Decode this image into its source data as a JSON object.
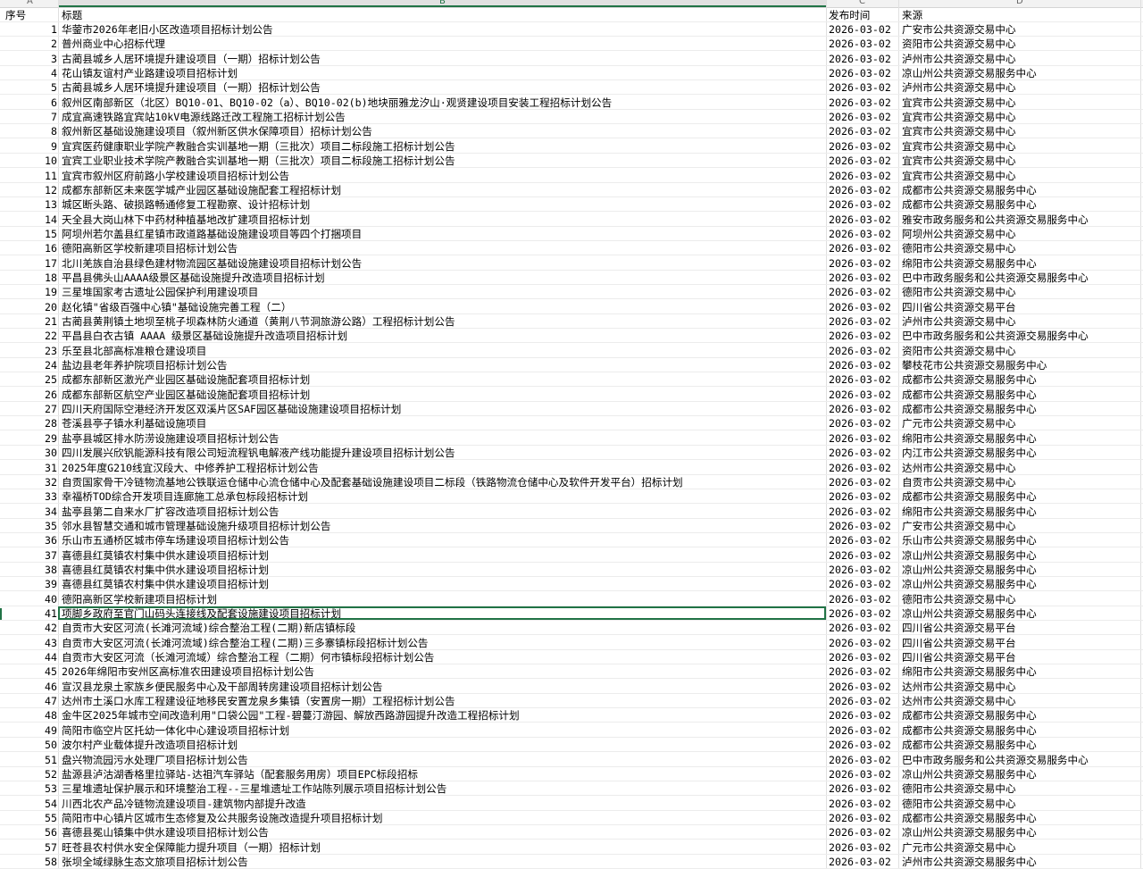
{
  "columns": [
    "A",
    "B",
    "C",
    "D"
  ],
  "header": {
    "a": "序号",
    "b": "标题",
    "c": "发布时间",
    "d": "来源"
  },
  "rows": [
    {
      "no": "1",
      "title": "华蓥市2026年老旧小区改造项目招标计划公告",
      "date": "2026-03-02",
      "source": "广安市公共资源交易中心"
    },
    {
      "no": "2",
      "title": "普州商业中心招标代理",
      "date": "2026-03-02",
      "source": "资阳市公共资源交易中心"
    },
    {
      "no": "3",
      "title": "古蔺县城乡人居环境提升建设项目（一期）招标计划公告",
      "date": "2026-03-02",
      "source": "泸州市公共资源交易中心"
    },
    {
      "no": "4",
      "title": "花山镇友谊村产业路建设项目招标计划",
      "date": "2026-03-02",
      "source": "凉山州公共资源交易服务中心"
    },
    {
      "no": "5",
      "title": "古蔺县城乡人居环境提升建设项目（一期）招标计划公告",
      "date": "2026-03-02",
      "source": "泸州市公共资源交易中心"
    },
    {
      "no": "6",
      "title": "叙州区南部新区（北区）BQ10-01、BQ10-02（a）、BQ10-02(b)地块丽雅龙汐山·观贤建设项目安装工程招标计划公告",
      "date": "2026-03-02",
      "source": "宜宾市公共资源交易中心"
    },
    {
      "no": "7",
      "title": "成宜高速铁路宜宾站10kV电源线路迁改工程施工招标计划公告",
      "date": "2026-03-02",
      "source": "宜宾市公共资源交易中心"
    },
    {
      "no": "8",
      "title": "叙州新区基础设施建设项目（叙州新区供水保障项目）招标计划公告",
      "date": "2026-03-02",
      "source": "宜宾市公共资源交易中心"
    },
    {
      "no": "9",
      "title": "宜宾医药健康职业学院产教融合实训基地一期（三批次）项目二标段施工招标计划公告",
      "date": "2026-03-02",
      "source": "宜宾市公共资源交易中心"
    },
    {
      "no": "10",
      "title": "宜宾工业职业技术学院产教融合实训基地一期（三批次）项目二标段施工招标计划公告",
      "date": "2026-03-02",
      "source": "宜宾市公共资源交易中心"
    },
    {
      "no": "11",
      "title": "宜宾市叙州区府前路小学校建设项目招标计划公告",
      "date": "2026-03-02",
      "source": "宜宾市公共资源交易中心"
    },
    {
      "no": "12",
      "title": "成都东部新区未来医学城产业园区基础设施配套工程招标计划",
      "date": "2026-03-02",
      "source": "成都市公共资源交易服务中心"
    },
    {
      "no": "13",
      "title": "城区断头路、破损路畅通修复工程勘察、设计招标计划",
      "date": "2026-03-02",
      "source": "成都市公共资源交易服务中心"
    },
    {
      "no": "14",
      "title": "天全县大岗山林下中药材种植基地改扩建项目招标计划",
      "date": "2026-03-02",
      "source": "雅安市政务服务和公共资源交易服务中心"
    },
    {
      "no": "15",
      "title": "阿坝州若尔盖县红星镇市政道路基础设施建设项目等四个打捆项目",
      "date": "2026-03-02",
      "source": "阿坝州公共资源交易中心"
    },
    {
      "no": "16",
      "title": "德阳高新区学校新建项目招标计划公告",
      "date": "2026-03-02",
      "source": "德阳市公共资源交易中心"
    },
    {
      "no": "17",
      "title": "北川羌族自治县绿色建材物流园区基础设施建设项目招标计划公告",
      "date": "2026-03-02",
      "source": "绵阳市公共资源交易服务中心"
    },
    {
      "no": "18",
      "title": "平昌县佛头山AAAA级景区基础设施提升改造项目招标计划",
      "date": "2026-03-02",
      "source": "巴中市政务服务和公共资源交易服务中心"
    },
    {
      "no": "19",
      "title": "三星堆国家考古遗址公园保护利用建设项目",
      "date": "2026-03-02",
      "source": "德阳市公共资源交易中心"
    },
    {
      "no": "20",
      "title": "赵化镇\"省级百强中心镇\"基础设施完善工程（二）",
      "date": "2026-03-02",
      "source": "四川省公共资源交易平台"
    },
    {
      "no": "21",
      "title": "古蔺县黄荆镇土地坝至桃子坝森林防火通道（黄荆八节洞旅游公路）工程招标计划公告",
      "date": "2026-03-02",
      "source": "泸州市公共资源交易中心"
    },
    {
      "no": "22",
      "title": "平昌县白衣古镇 AAAA 级景区基础设施提升改造项目招标计划",
      "date": "2026-03-02",
      "source": "巴中市政务服务和公共资源交易服务中心"
    },
    {
      "no": "23",
      "title": "乐至县北部高标准粮仓建设项目",
      "date": "2026-03-02",
      "source": "资阳市公共资源交易中心"
    },
    {
      "no": "24",
      "title": "盐边县老年养护院项目招标计划公告",
      "date": "2026-03-02",
      "source": "攀枝花市公共资源交易服务中心"
    },
    {
      "no": "25",
      "title": "成都东部新区激光产业园区基础设施配套项目招标计划",
      "date": "2026-03-02",
      "source": "成都市公共资源交易服务中心"
    },
    {
      "no": "26",
      "title": "成都东部新区航空产业园区基础设施配套项目招标计划",
      "date": "2026-03-02",
      "source": "成都市公共资源交易服务中心"
    },
    {
      "no": "27",
      "title": "四川天府国际空港经济开发区双溪片区SAF园区基础设施建设项目招标计划",
      "date": "2026-03-02",
      "source": "成都市公共资源交易服务中心"
    },
    {
      "no": "28",
      "title": "苍溪县亭子镇水利基础设施项目",
      "date": "2026-03-02",
      "source": "广元市公共资源交易中心"
    },
    {
      "no": "29",
      "title": "盐亭县城区排水防涝设施建设项目招标计划公告",
      "date": "2026-03-02",
      "source": "绵阳市公共资源交易服务中心"
    },
    {
      "no": "30",
      "title": "四川发展兴欣钒能源科技有限公司短流程钒电解液产线功能提升建设项目招标计划公告",
      "date": "2026-03-02",
      "source": "内江市公共资源交易服务中心"
    },
    {
      "no": "31",
      "title": "2025年度G210线宜汉段大、中修养护工程招标计划公告",
      "date": "2026-03-02",
      "source": "达州市公共资源交易中心"
    },
    {
      "no": "32",
      "title": "自贡国家骨干冷链物流基地公铁联运仓储中心流仓储中心及配套基础设施建设项目二标段（铁路物流仓储中心及软件开发平台）招标计划",
      "date": "2026-03-02",
      "source": "自贡市公共资源交易中心"
    },
    {
      "no": "33",
      "title": "幸福桥TOD综合开发项目连廊施工总承包标段招标计划",
      "date": "2026-03-02",
      "source": "成都市公共资源交易服务中心"
    },
    {
      "no": "34",
      "title": "盐亭县第二自来水厂扩容改造项目招标计划公告",
      "date": "2026-03-02",
      "source": "绵阳市公共资源交易服务中心"
    },
    {
      "no": "35",
      "title": "邻水县智慧交通和城市管理基础设施升级项目招标计划公告",
      "date": "2026-03-02",
      "source": "广安市公共资源交易中心"
    },
    {
      "no": "36",
      "title": "乐山市五通桥区城市停车场建设项目招标计划公告",
      "date": "2026-03-02",
      "source": "乐山市公共资源交易服务中心"
    },
    {
      "no": "37",
      "title": "喜德县红莫镇农村集中供水建设项目招标计划",
      "date": "2026-03-02",
      "source": "凉山州公共资源交易服务中心"
    },
    {
      "no": "38",
      "title": "喜德县红莫镇农村集中供水建设项目招标计划",
      "date": "2026-03-02",
      "source": "凉山州公共资源交易服务中心"
    },
    {
      "no": "39",
      "title": "喜德县红莫镇农村集中供水建设项目招标计划",
      "date": "2026-03-02",
      "source": "凉山州公共资源交易服务中心"
    },
    {
      "no": "40",
      "title": "德阳高新区学校新建项目招标计划",
      "date": "2026-03-02",
      "source": "德阳市公共资源交易中心"
    },
    {
      "no": "41",
      "title": "项脚乡政府至官门山码头连接线及配套设施建设项目招标计划",
      "date": "2026-03-02",
      "source": "凉山州公共资源交易服务中心"
    },
    {
      "no": "42",
      "title": "自贡市大安区河流(长滩河流域)综合整治工程(二期)新店镇标段",
      "date": "2026-03-02",
      "source": "四川省公共资源交易平台"
    },
    {
      "no": "43",
      "title": "自贡市大安区河流(长滩河流域)综合整治工程(二期)三多寨镇标段招标计划公告",
      "date": "2026-03-02",
      "source": "四川省公共资源交易平台"
    },
    {
      "no": "44",
      "title": "自贡市大安区河流（长滩河流域）综合整治工程（二期）何市镇标段招标计划公告",
      "date": "2026-03-02",
      "source": "四川省公共资源交易平台"
    },
    {
      "no": "45",
      "title": "2026年绵阳市安州区高标准农田建设项目招标计划公告",
      "date": "2026-03-02",
      "source": "绵阳市公共资源交易服务中心"
    },
    {
      "no": "46",
      "title": "宣汉县龙泉土家族乡便民服务中心及干部周转房建设项目招标计划公告",
      "date": "2026-03-02",
      "source": "达州市公共资源交易中心"
    },
    {
      "no": "47",
      "title": "达州市土溪口水库工程建设征地移民安置龙泉乡集镇（安置房一期）工程招标计划公告",
      "date": "2026-03-02",
      "source": "达州市公共资源交易中心"
    },
    {
      "no": "48",
      "title": "金牛区2025年城市空间改造利用\"口袋公园\"工程-碧蔓汀游园、解放西路游园提升改造工程招标计划",
      "date": "2026-03-02",
      "source": "成都市公共资源交易服务中心"
    },
    {
      "no": "49",
      "title": "简阳市临空片区托幼一体化中心建设项目招标计划",
      "date": "2026-03-02",
      "source": "成都市公共资源交易服务中心"
    },
    {
      "no": "50",
      "title": "波尔村产业载体提升改造项目招标计划",
      "date": "2026-03-02",
      "source": "成都市公共资源交易服务中心"
    },
    {
      "no": "51",
      "title": "盘兴物流园污水处理厂项目招标计划公告",
      "date": "2026-03-02",
      "source": "巴中市政务服务和公共资源交易服务中心"
    },
    {
      "no": "52",
      "title": "盐源县泸沽湖香格里拉驿站-达祖汽车驿站（配套服务用房）项目EPC标段招标",
      "date": "2026-03-02",
      "source": "凉山州公共资源交易服务中心"
    },
    {
      "no": "53",
      "title": "三星堆遗址保护展示和环境整治工程--三星堆遗址工作站陈列展示项目招标计划公告",
      "date": "2026-03-02",
      "source": "德阳市公共资源交易中心"
    },
    {
      "no": "54",
      "title": "川西北农产品冷链物流建设项目-建筑物内部提升改造",
      "date": "2026-03-02",
      "source": "德阳市公共资源交易中心"
    },
    {
      "no": "55",
      "title": "简阳市中心镇片区城市生态修复及公共服务设施改造提升项目招标计划",
      "date": "2026-03-02",
      "source": "成都市公共资源交易服务中心"
    },
    {
      "no": "56",
      "title": "喜德县冕山镇集中供水建设项目招标计划公告",
      "date": "2026-03-02",
      "source": "凉山州公共资源交易服务中心"
    },
    {
      "no": "57",
      "title": "旺苍县农村供水安全保障能力提升项目（一期）招标计划",
      "date": "2026-03-02",
      "source": "广元市公共资源交易中心"
    },
    {
      "no": "58",
      "title": "张坝全域绿脉生态文旅项目招标计划公告",
      "date": "2026-03-02",
      "source": "泸州市公共资源交易服务中心"
    }
  ]
}
